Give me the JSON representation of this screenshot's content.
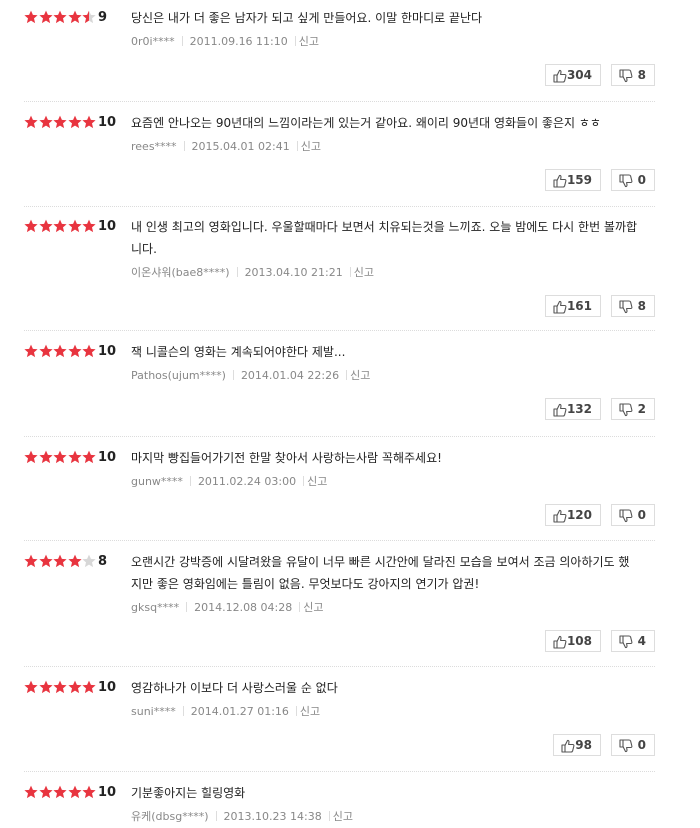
{
  "reviews": [
    {
      "score": "9",
      "stars": 4.5,
      "text": "당신은 내가 더 좋은 남자가 되고 싶게 만들어요. 이말 한마디로 끝난다",
      "author": "0r0i****",
      "date": "2011.09.16 11:10",
      "report": "신고",
      "likes": "304",
      "dislikes": "8"
    },
    {
      "score": "10",
      "stars": 5,
      "text": "요즘엔 안나오는 90년대의 느낌이라는게 있는거 같아요. 왜이리 90년대 영화들이 좋은지 ㅎㅎ",
      "author": "rees****",
      "date": "2015.04.01 02:41",
      "report": "신고",
      "likes": "159",
      "dislikes": "0"
    },
    {
      "score": "10",
      "stars": 5,
      "text": "내 인생 최고의 영화입니다. 우울할때마다 보면서 치유되는것을 느끼죠. 오늘 밤에도 다시 한번 볼까합니다.",
      "author": "이온샤워(bae8****)",
      "date": "2013.04.10 21:21",
      "report": "신고",
      "likes": "161",
      "dislikes": "8"
    },
    {
      "score": "10",
      "stars": 5,
      "text": "잭 니콜슨의 영화는 계속되어야한다 제발...",
      "author": "Pathos(ujum****)",
      "date": "2014.01.04 22:26",
      "report": "신고",
      "likes": "132",
      "dislikes": "2"
    },
    {
      "score": "10",
      "stars": 5,
      "text": "마지막 빵집들어가기전 한말 찾아서 사랑하는사람 꼭해주세요!",
      "author": "gunw****",
      "date": "2011.02.24 03:00",
      "report": "신고",
      "likes": "120",
      "dislikes": "0"
    },
    {
      "score": "8",
      "stars": 4,
      "text": "오랜시간 강박증에 시달려왔을 유달이 너무 빠른 시간안에 달라진 모습을 보여서 조금 의아하기도 했지만 좋은 영화임에는 틀림이 없음. 무엇보다도 강아지의 연기가 압권!",
      "author": "gksq****",
      "date": "2014.12.08 04:28",
      "report": "신고",
      "likes": "108",
      "dislikes": "4"
    },
    {
      "score": "10",
      "stars": 5,
      "text": "영감하나가 이보다 더 사랑스러울 순 없다",
      "author": "suni****",
      "date": "2014.01.27 01:16",
      "report": "신고",
      "likes": "98",
      "dislikes": "0"
    },
    {
      "score": "10",
      "stars": 5,
      "text": "기분좋아지는 힐링영화",
      "author": "유케(dbsg****)",
      "date": "2013.10.23 14:38",
      "report": "신고",
      "likes": null,
      "dislikes": null
    }
  ],
  "colors": {
    "star_on": "#e8343f",
    "star_off": "#d7d7d7",
    "score": "#222222",
    "meta": "#888888"
  },
  "icons": {
    "like": "thumb-up-icon",
    "dislike": "thumb-down-icon",
    "star": "star-icon"
  }
}
